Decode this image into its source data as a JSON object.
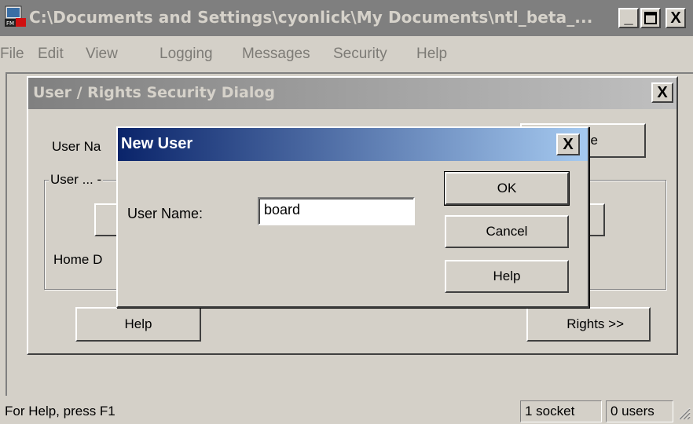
{
  "window": {
    "title": "C:\\Documents and Settings\\cyonlick\\My Documents\\ntl_beta_...",
    "minimize": "_",
    "maximize": "□",
    "close": "X"
  },
  "menu": [
    "File",
    "Edit",
    "View",
    "Logging",
    "Messages",
    "Security",
    "Help"
  ],
  "status": {
    "help_text": "For Help, press F1",
    "sockets": "1 socket",
    "users": "0 users"
  },
  "security_dialog": {
    "title": "User / Rights Security Dialog",
    "close": "X",
    "user_name_label": "User Na",
    "right_button_partial": "ne",
    "group_label": "User ... -",
    "home_dir_label": "Home D",
    "help_button": "Help",
    "rights_button": "Rights >>"
  },
  "new_user_dialog": {
    "title": "New User",
    "close": "X",
    "user_name_label": "User Name:",
    "user_name_value": "board",
    "ok_button": "OK",
    "cancel_button": "Cancel",
    "help_button": "Help"
  },
  "colors": {
    "face": "#d4d0c8",
    "inactive_title": "#808080",
    "active_title_start": "#0a246a",
    "active_title_end": "#a6caf0"
  }
}
